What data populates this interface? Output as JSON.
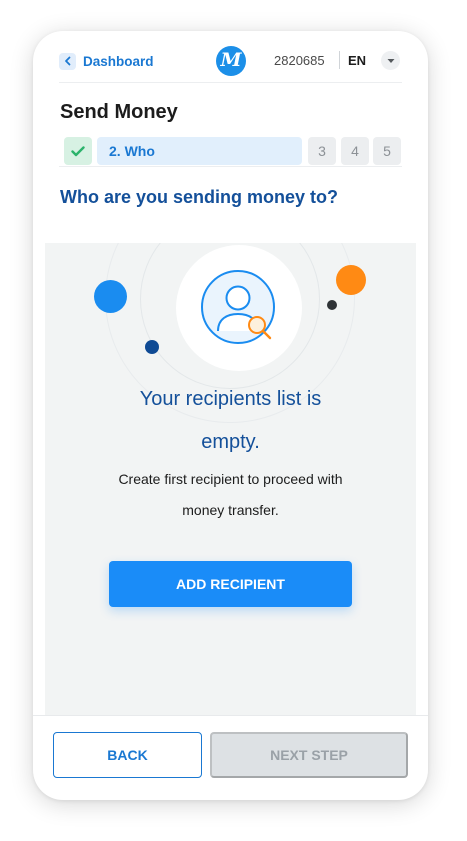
{
  "header": {
    "back_label": "Dashboard",
    "logo_letter": "M",
    "account_id": "2820685",
    "language": "EN"
  },
  "page": {
    "title": "Send Money",
    "question": "Who are you sending money to?"
  },
  "stepper": {
    "active_label": "2.  Who",
    "steps": [
      "3",
      "4",
      "5"
    ]
  },
  "empty_state": {
    "title_line1": "Your recipients list is",
    "title_line2": "empty.",
    "desc_line1": "Create first recipient to proceed with",
    "desc_line2": "money transfer.",
    "button": "ADD RECIPIENT"
  },
  "footer": {
    "back": "BACK",
    "next": "NEXT STEP"
  },
  "colors": {
    "primary": "#1a8cf8",
    "link": "#1a78d2",
    "heading": "#14509a",
    "success": "#2bb36b",
    "accent_orange": "#ff8a14"
  },
  "icons": {
    "back": "chevron-left-icon",
    "dropdown": "chevron-down-icon",
    "completed_step": "check-icon",
    "illustration": "user-search-icon"
  }
}
